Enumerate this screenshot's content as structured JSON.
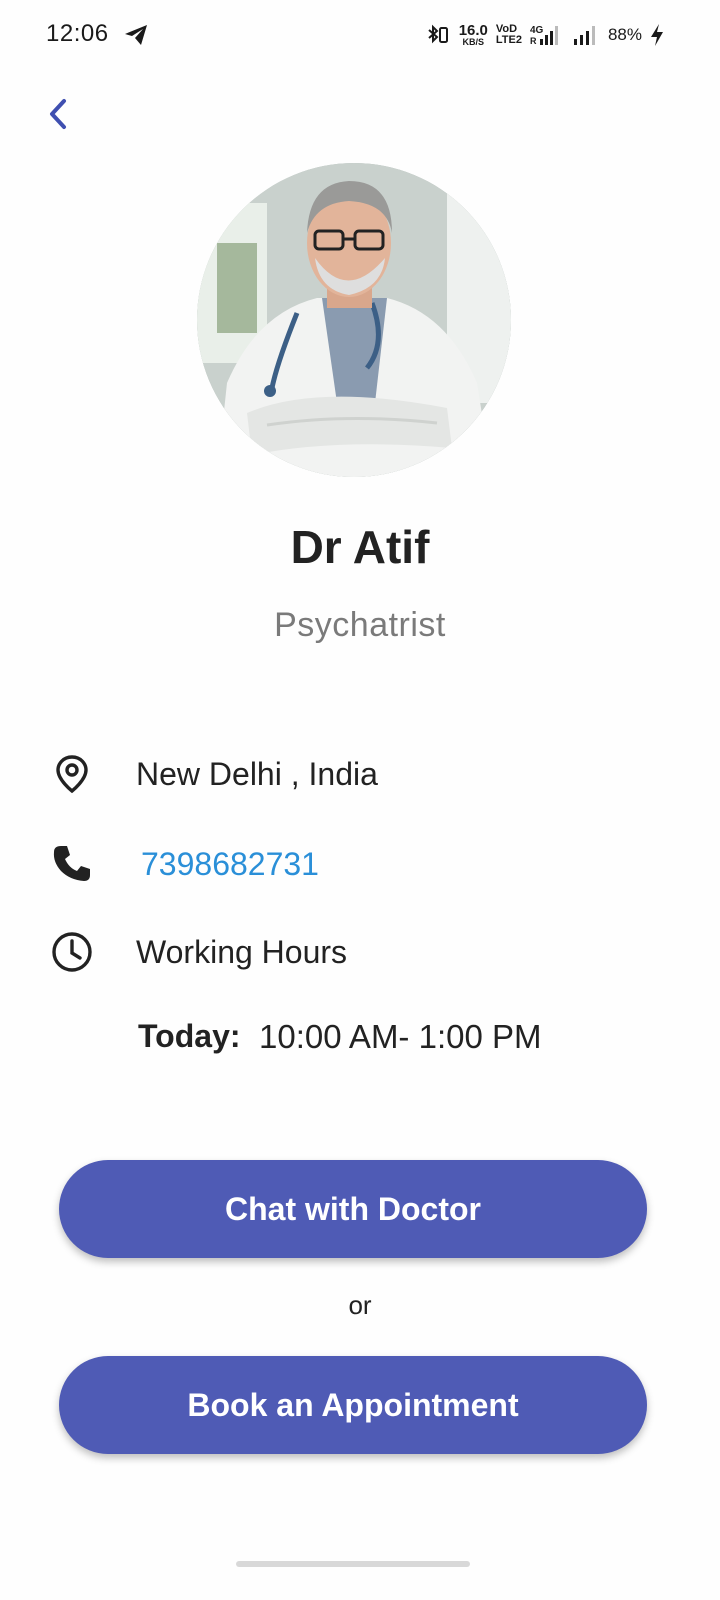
{
  "status_bar": {
    "time": "12:06",
    "net_speed_value": "16.0",
    "net_speed_unit": "KB/S",
    "volte_top": "VoD",
    "volte_bottom": "LTE2",
    "network": "4G",
    "network_r": "R",
    "battery": "88%"
  },
  "doctor": {
    "name": "Dr Atif",
    "specialty": "Psychatrist"
  },
  "info": {
    "location": "New Delhi , India",
    "phone": "7398682731",
    "hours_label": "Working Hours",
    "today_label": "Today:",
    "today_value": "10:00 AM- 1:00 PM"
  },
  "actions": {
    "chat_label": "Chat with Doctor",
    "or_label": "or",
    "book_label": "Book an Appointment"
  },
  "colors": {
    "accent": "#4f5bb5",
    "back_arrow": "#3f4fb0",
    "phone_link": "#2a8fd8",
    "subtitle": "#7a7a7a"
  },
  "icons": {
    "back": "chevron-left-icon",
    "location": "location-pin-icon",
    "phone": "phone-icon",
    "hours": "clock-icon"
  }
}
